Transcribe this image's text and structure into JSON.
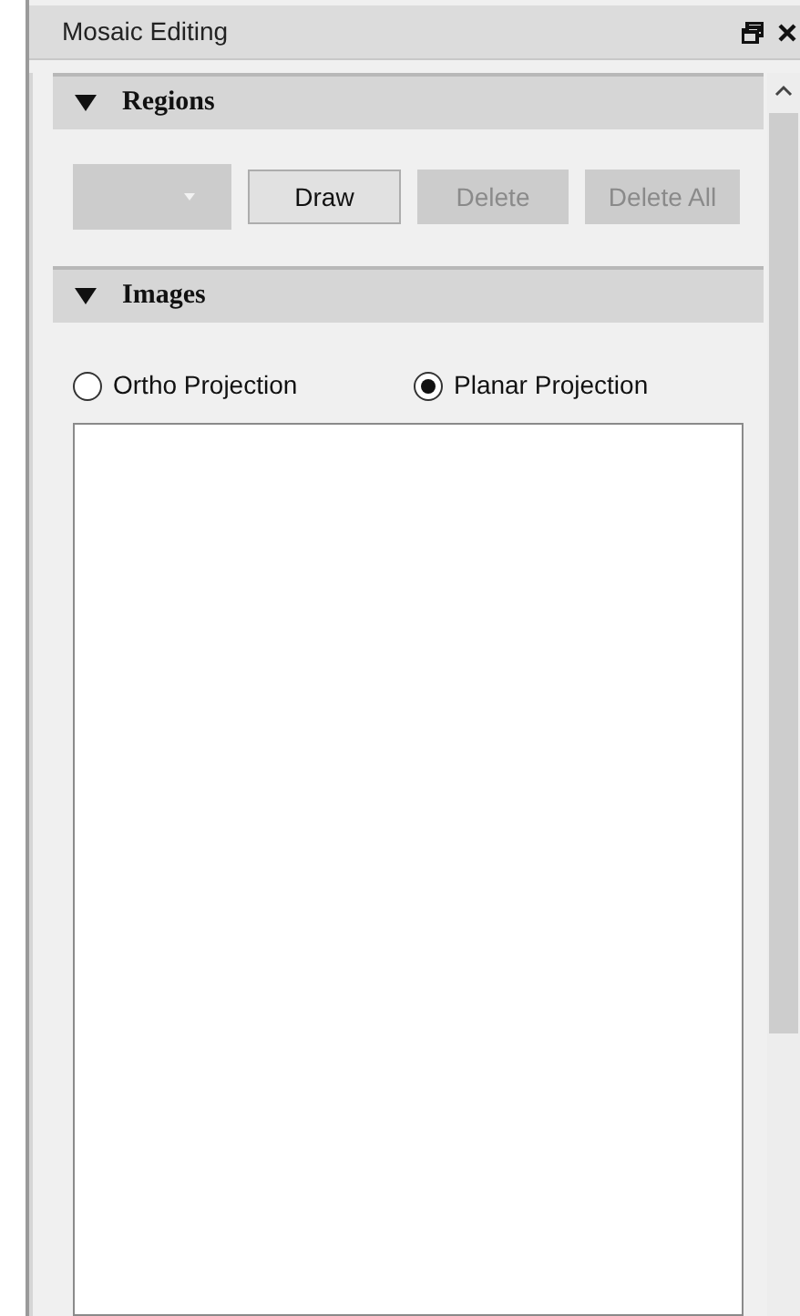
{
  "panel": {
    "title": "Mosaic Editing"
  },
  "sections": [
    {
      "kind": "buttons",
      "title": "Regions",
      "expanded": true,
      "dropdown": {
        "disabled": true
      },
      "buttons": [
        {
          "label": "Draw",
          "disabled": false
        },
        {
          "label": "Delete",
          "disabled": true
        },
        {
          "label": "Delete All",
          "disabled": true
        }
      ]
    },
    {
      "kind": "images",
      "title": "Images",
      "expanded": true,
      "radios": [
        {
          "label": "Ortho Projection",
          "selected": false
        },
        {
          "label": "Planar Projection",
          "selected": true
        }
      ]
    }
  ]
}
